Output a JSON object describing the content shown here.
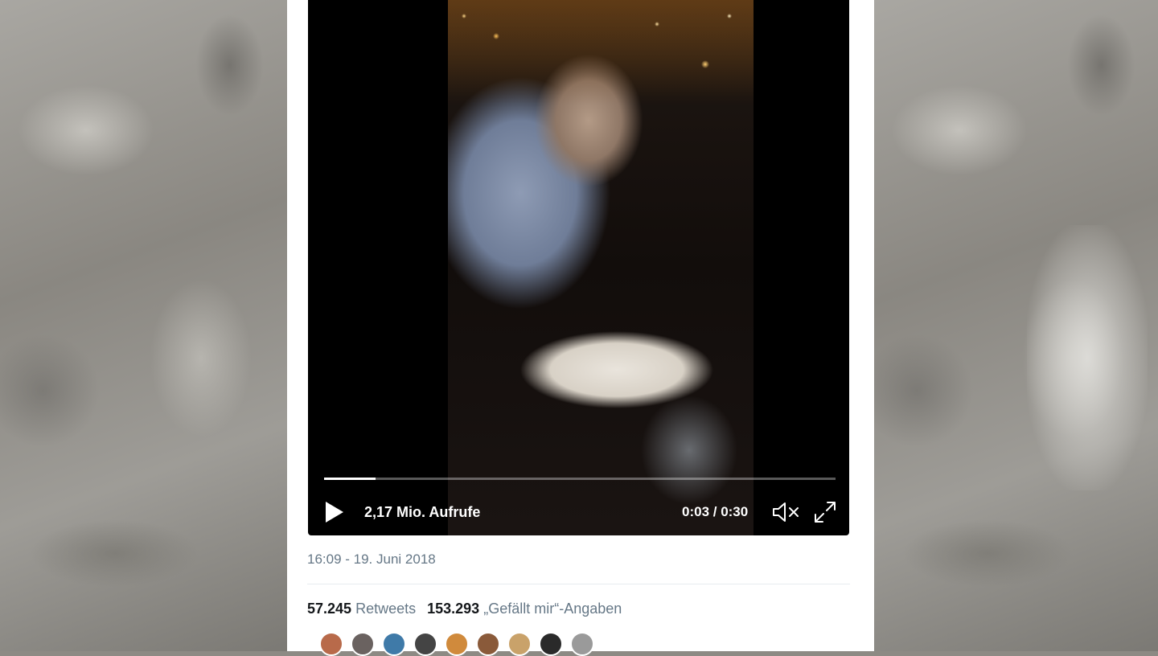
{
  "video": {
    "views": "2,17 Mio. Aufrufe",
    "time": "0:03 / 0:30",
    "progress": 0.1,
    "icons": [
      "play-icon",
      "mute-icon",
      "fullscreen-icon"
    ]
  },
  "tweet": {
    "timestamp": "16:09 - 19. Juni 2018",
    "retweets_count": "57.245",
    "retweets_label": "Retweets",
    "likes_count": "153.293",
    "likes_label": "„Gefällt mir“-Angaben"
  },
  "avatars": [
    {
      "color": "#b86a4a"
    },
    {
      "color": "#6a6260"
    },
    {
      "color": "#3f7aa8"
    },
    {
      "color": "#444444"
    },
    {
      "color": "#d08a3c"
    },
    {
      "color": "#8a5a3a"
    },
    {
      "color": "#c9a26a"
    },
    {
      "color": "#2a2a2a"
    },
    {
      "color": "#9a9a9a"
    }
  ]
}
